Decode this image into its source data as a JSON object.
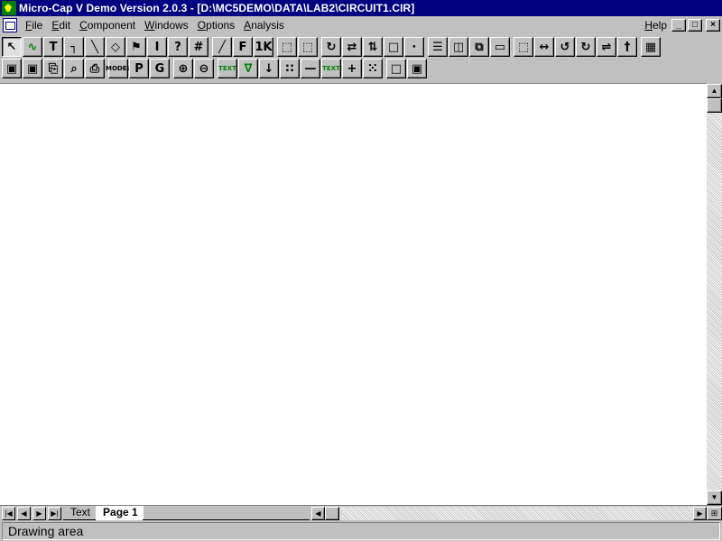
{
  "window": {
    "title": "Micro-Cap V Demo Version 2.0.3 - [D:\\MC5DEMO\\DATA\\LAB2\\CIRCUIT1.CIR]"
  },
  "menubar": {
    "items": [
      {
        "label": "File",
        "accel": "F",
        "rest": "ile"
      },
      {
        "label": "Edit",
        "accel": "E",
        "rest": "dit"
      },
      {
        "label": "Component",
        "accel": "C",
        "rest": "omponent"
      },
      {
        "label": "Windows",
        "accel": "W",
        "rest": "indows"
      },
      {
        "label": "Options",
        "accel": "O",
        "rest": "ptions"
      },
      {
        "label": "Analysis",
        "accel": "A",
        "rest": "nalysis"
      }
    ],
    "help": {
      "accel": "H",
      "rest": "elp"
    },
    "mdi_buttons": [
      "_",
      "□",
      "×"
    ]
  },
  "toolbar_row1": [
    {
      "icon": "select-arrow-icon",
      "glyph": "↖",
      "pressed": true
    },
    {
      "icon": "wire-squiggle-icon",
      "glyph": "∿",
      "green": true
    },
    {
      "icon": "text-tool-icon",
      "glyph": "T"
    },
    {
      "icon": "orthogonal-wire-icon",
      "glyph": "┐"
    },
    {
      "icon": "diagonal-wire-icon",
      "glyph": "╲"
    },
    {
      "icon": "shapes-icon",
      "glyph": "◇"
    },
    {
      "icon": "flag-icon",
      "glyph": "⚑"
    },
    {
      "icon": "info-icon",
      "glyph": "I"
    },
    {
      "icon": "help-icon",
      "glyph": "?"
    },
    {
      "icon": "component-hash-icon",
      "glyph": "#"
    },
    {
      "icon": "grid-hatch-icon",
      "glyph": "╱"
    },
    {
      "icon": "find-icon",
      "glyph": "F"
    },
    {
      "icon": "kilo-icon",
      "glyph": "1K"
    },
    {
      "icon": "box-dotted-icon",
      "glyph": "⬚"
    },
    {
      "icon": "box-dotted-2-icon",
      "glyph": "⬚"
    },
    {
      "icon": "rotate-icon",
      "glyph": "↻"
    },
    {
      "icon": "flip-horizontal-icon",
      "glyph": "⇄"
    },
    {
      "icon": "flip-vertical-icon",
      "glyph": "⇅"
    },
    {
      "icon": "mirror-icon",
      "glyph": "□"
    },
    {
      "icon": "node-icon",
      "glyph": "∙"
    },
    {
      "icon": "tile-horizontal-icon",
      "glyph": "☰"
    },
    {
      "icon": "tile-vertical-icon",
      "glyph": "◫"
    },
    {
      "icon": "cascade-icon",
      "glyph": "⧉"
    },
    {
      "icon": "maximize-window-icon",
      "glyph": "▭"
    },
    {
      "icon": "zoom-region-icon",
      "glyph": "⬚"
    },
    {
      "icon": "bidirectional-icon",
      "glyph": "↔"
    },
    {
      "icon": "rotate-left-icon",
      "glyph": "↺"
    },
    {
      "icon": "rotate-right-icon",
      "glyph": "↻"
    },
    {
      "icon": "mirror-horizontal-icon",
      "glyph": "⇌"
    },
    {
      "icon": "probe-icon",
      "glyph": "†"
    },
    {
      "icon": "calculator-icon",
      "glyph": "▦"
    }
  ],
  "toolbar_row2": [
    {
      "icon": "save-icon",
      "glyph": "▣"
    },
    {
      "icon": "save-all-icon",
      "glyph": "▣"
    },
    {
      "icon": "print-preview-doc-icon",
      "glyph": "⎘"
    },
    {
      "icon": "print-preview-icon",
      "glyph": "⌕"
    },
    {
      "icon": "printer-icon",
      "glyph": "⎙"
    },
    {
      "icon": "model-icon",
      "glyph": "MODEL",
      "small": true
    },
    {
      "icon": "pin-p-icon",
      "glyph": "P"
    },
    {
      "icon": "ground-g-icon",
      "glyph": "G"
    },
    {
      "icon": "zoom-in-icon",
      "glyph": "⊕"
    },
    {
      "icon": "zoom-out-icon",
      "glyph": "⊖"
    },
    {
      "icon": "text-label-icon",
      "glyph": "TEXT",
      "small": true,
      "green": true
    },
    {
      "icon": "node-numbers-icon",
      "glyph": "∇",
      "green": true
    },
    {
      "icon": "pin-connections-icon",
      "glyph": "↓"
    },
    {
      "icon": "grid-dots-icon",
      "glyph": "∷"
    },
    {
      "icon": "line-tool-icon",
      "glyph": "—"
    },
    {
      "icon": "attribute-text-icon",
      "glyph": "TEXT",
      "small": true,
      "green": true
    },
    {
      "icon": "crosshair-icon",
      "glyph": "+"
    },
    {
      "icon": "grid-toggle-icon",
      "glyph": "⁙"
    },
    {
      "icon": "border-icon",
      "glyph": "□"
    },
    {
      "icon": "title-block-icon",
      "glyph": "▣"
    }
  ],
  "tabs": {
    "text_tab": "Text",
    "page_tab": "Page 1"
  },
  "status": {
    "text": "Drawing area"
  }
}
